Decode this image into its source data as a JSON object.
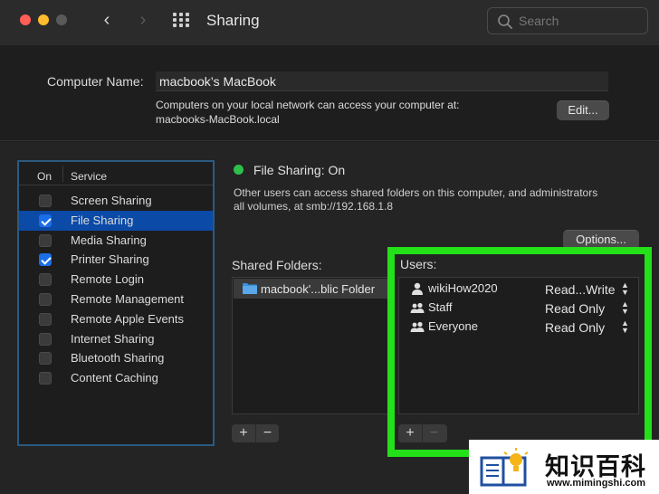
{
  "window": {
    "title": "Sharing",
    "search_placeholder": "Search"
  },
  "computer": {
    "name_label": "Computer Name:",
    "name_value": "macbook’s MacBook",
    "desc_line1": "Computers on your local network can access your computer at:",
    "desc_line2": "macbooks-MacBook.local",
    "edit_label": "Edit..."
  },
  "services": {
    "col_on": "On",
    "col_service": "Service",
    "items": [
      {
        "label": "Screen Sharing",
        "checked": false,
        "selected": false
      },
      {
        "label": "File Sharing",
        "checked": true,
        "selected": true
      },
      {
        "label": "Media Sharing",
        "checked": false,
        "selected": false
      },
      {
        "label": "Printer Sharing",
        "checked": true,
        "selected": false
      },
      {
        "label": "Remote Login",
        "checked": false,
        "selected": false
      },
      {
        "label": "Remote Management",
        "checked": false,
        "selected": false
      },
      {
        "label": "Remote Apple Events",
        "checked": false,
        "selected": false
      },
      {
        "label": "Internet Sharing",
        "checked": false,
        "selected": false
      },
      {
        "label": "Bluetooth Sharing",
        "checked": false,
        "selected": false
      },
      {
        "label": "Content Caching",
        "checked": false,
        "selected": false
      }
    ]
  },
  "file_sharing": {
    "status": "File Sharing: On",
    "status_color": "#2fbf4b",
    "desc_line1": "Other users can access shared folders on this computer, and administrators",
    "desc_line2": "all volumes, at smb://192.168.1.8",
    "options_label": "Options..."
  },
  "shared_folders": {
    "label": "Shared Folders:",
    "items": [
      "macbook'...blic Folder"
    ]
  },
  "users": {
    "label": "Users:",
    "items": [
      {
        "name": "wikiHow2020",
        "permission": "Read...Write",
        "icon": "single-user-icon"
      },
      {
        "name": "Staff",
        "permission": "Read Only",
        "icon": "group-icon"
      },
      {
        "name": "Everyone",
        "permission": "Read Only",
        "icon": "group-icon"
      }
    ]
  },
  "controls": {
    "plus": "+",
    "minus": "−"
  },
  "watermark": {
    "brand": "知识百科",
    "url": "www.mimingshi.com"
  },
  "colors": {
    "highlight": "#23e019",
    "selection": "#0b4aa6",
    "checkbox": "#1a6ee8"
  }
}
